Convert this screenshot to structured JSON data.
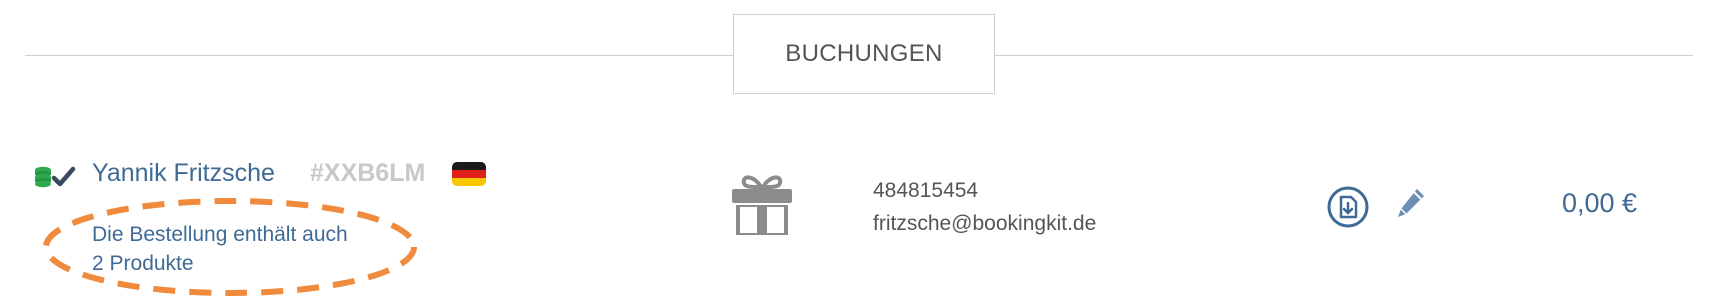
{
  "section": {
    "title": "BUCHUNGEN"
  },
  "booking": {
    "status_icons": [
      "coins-paid-icon",
      "checkmark-icon"
    ],
    "customer_name": "Yannik Fritzsche",
    "booking_code": "#XXB6LM",
    "country_flag": "germany-flag-icon",
    "products_note": {
      "line1": "Die Bestellung enthält auch",
      "line2": "2 Produkte"
    },
    "type_icon": "gift-icon",
    "phone": "484815454",
    "email": "fritzsche@bookingkit.de",
    "actions": [
      "download-icon",
      "edit-icon"
    ],
    "price": "0,00 €"
  },
  "colors": {
    "link": "#3f6a96",
    "muted": "#c8c8c8",
    "text": "#555555",
    "divider": "#cfcfcf",
    "highlight": "#f08a3c",
    "paid_green": "#2daa4f"
  }
}
